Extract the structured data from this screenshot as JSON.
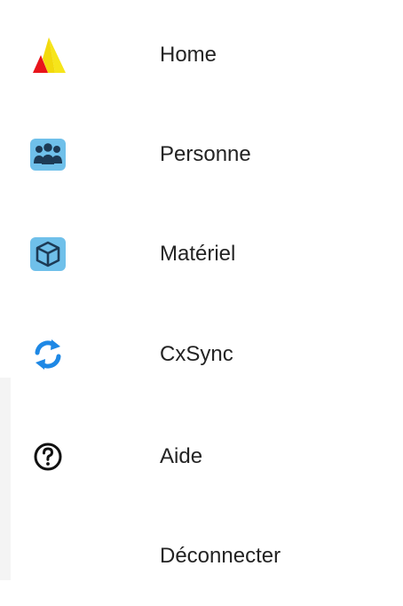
{
  "menu": {
    "items": [
      {
        "label": "Home",
        "icon": "app-logo-icon"
      },
      {
        "label": "Personne",
        "icon": "people-group-icon"
      },
      {
        "label": "Matériel",
        "icon": "cube-icon"
      },
      {
        "label": "CxSync",
        "icon": "sync-arrows-icon"
      },
      {
        "label": "Aide",
        "icon": "help-circle-icon"
      },
      {
        "label": "Déconnecter",
        "icon": null
      }
    ]
  },
  "colors": {
    "logo_red": "#e8141b",
    "logo_yellow": "#f6e51a",
    "icon_tile_blue": "#6fc0ea",
    "icon_glyph_dark": "#1d3b56",
    "sync_blue": "#1e88e5",
    "text": "#232323"
  }
}
